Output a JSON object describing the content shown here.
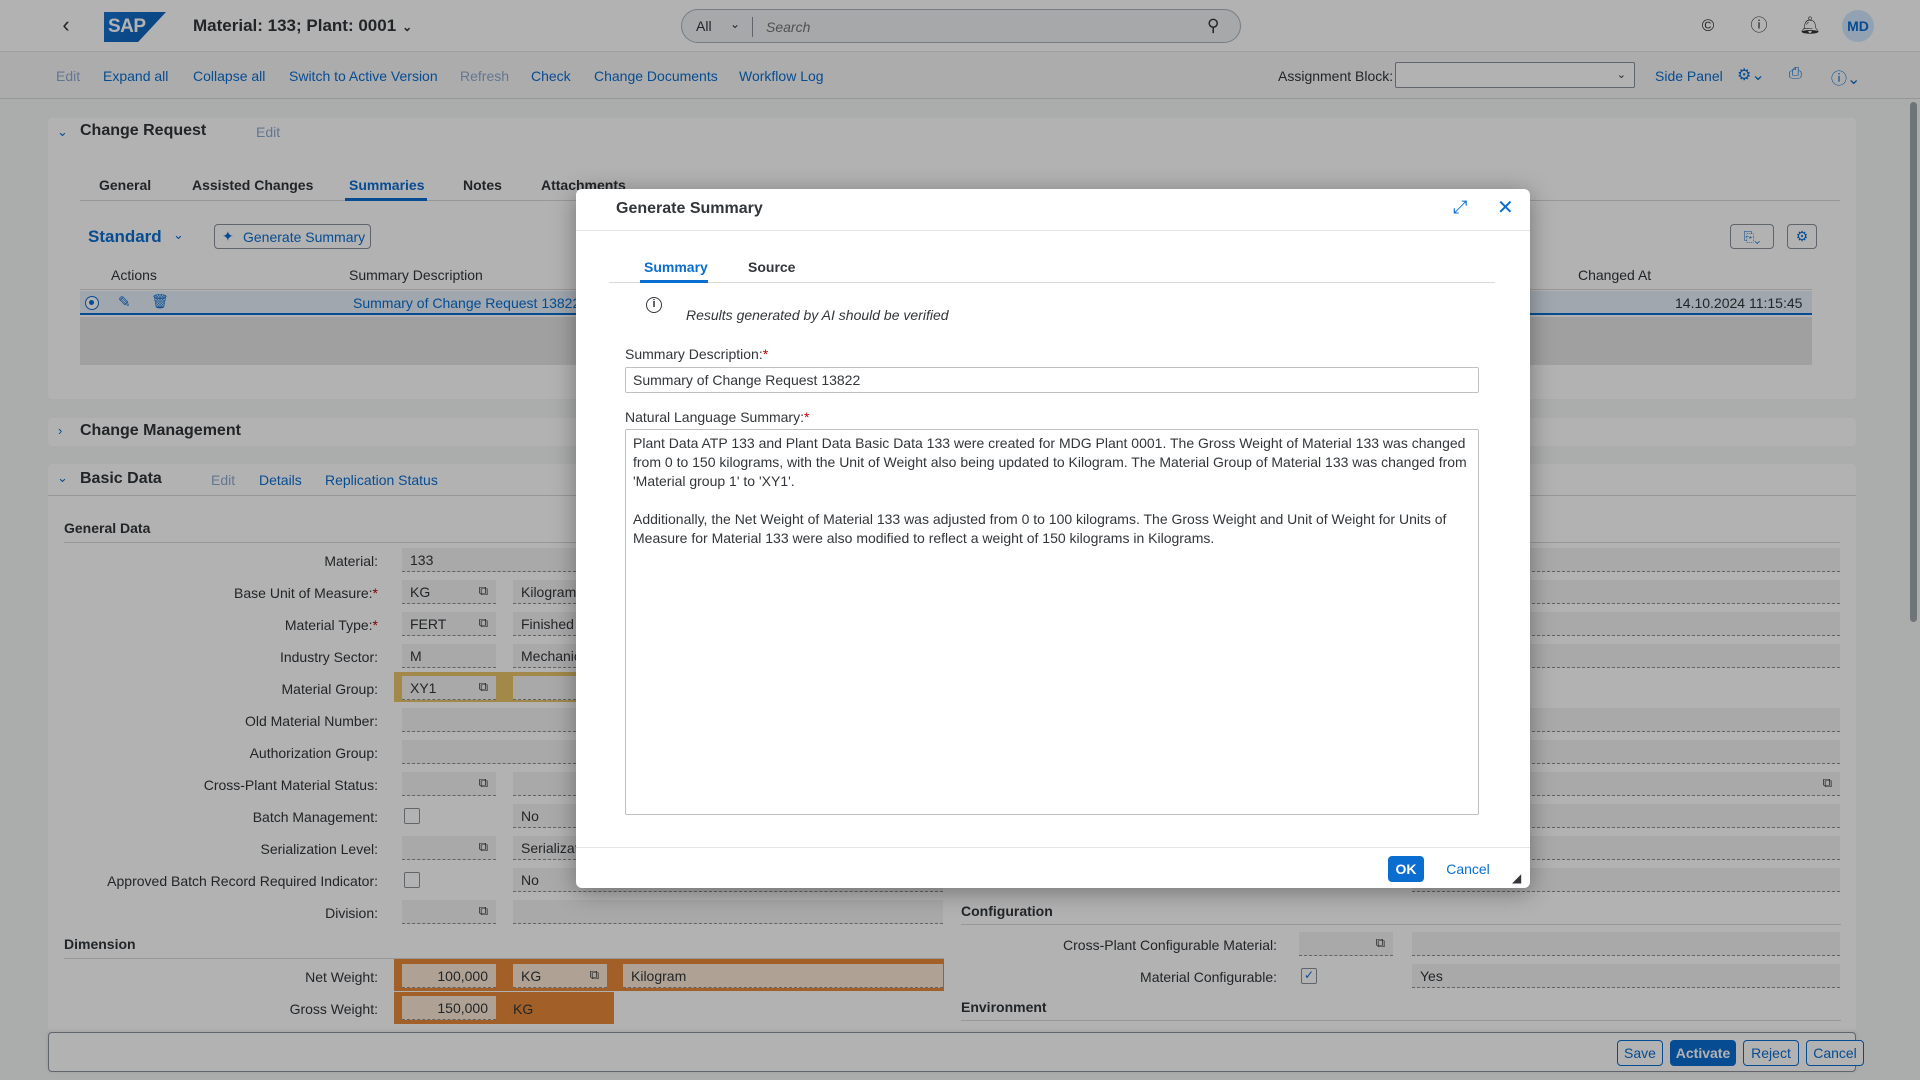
{
  "shell": {
    "app_title": "Material: 133; Plant: 0001",
    "logo": "SAP",
    "search_scope": "All",
    "search_placeholder": "Search",
    "avatar_initials": "MD"
  },
  "toolbar": {
    "edit": "Edit",
    "expand_all": "Expand all",
    "collapse_all": "Collapse all",
    "switch_active": "Switch to Active Version",
    "refresh": "Refresh",
    "check": "Check",
    "change_documents": "Change Documents",
    "workflow_log": "Workflow Log",
    "assignment_block_label": "Assignment Block:",
    "assignment_block_value": "",
    "side_panel": "Side Panel"
  },
  "change_request": {
    "title": "Change Request",
    "edit": "Edit",
    "tabs": [
      "General",
      "Assisted Changes",
      "Summaries",
      "Notes",
      "Attachments"
    ],
    "active_tab": "Summaries",
    "variant": "Standard",
    "generate_button": "Generate Summary",
    "columns": {
      "actions": "Actions",
      "description": "Summary Description",
      "changed_at": "Changed At"
    },
    "row": {
      "description": "Summary of Change Request 13822",
      "changed_at": "14.10.2024 11:15:45"
    }
  },
  "change_management": {
    "title": "Change Management"
  },
  "basic_data": {
    "title": "Basic Data",
    "links": {
      "edit": "Edit",
      "details": "Details",
      "replication": "Replication Status"
    },
    "general_data_title": "General Data",
    "dimension_title": "Dimension",
    "configuration_title": "Configuration",
    "environment_title": "Environment",
    "fields": {
      "material": {
        "label": "Material:",
        "value": "133"
      },
      "base_uom": {
        "label": "Base Unit of Measure:",
        "value": "KG",
        "desc": "Kilogram"
      },
      "material_type": {
        "label": "Material Type:",
        "value": "FERT",
        "desc": "Finished"
      },
      "industry_sector": {
        "label": "Industry Sector:",
        "value": "M",
        "desc": "Mechanic"
      },
      "material_group": {
        "label": "Material Group:",
        "value": "XY1",
        "desc": ""
      },
      "old_material_number": {
        "label": "Old Material Number:",
        "value": ""
      },
      "authorization_group": {
        "label": "Authorization Group:",
        "value": ""
      },
      "cross_plant_status": {
        "label": "Cross-Plant Material Status:",
        "value": ""
      },
      "batch_management": {
        "label": "Batch Management:",
        "desc": "No"
      },
      "serialization_level": {
        "label": "Serialization Level:",
        "desc": "Serializat"
      },
      "approved_batch": {
        "label": "Approved Batch Record Required Indicator:",
        "desc": "No"
      },
      "division": {
        "label": "Division:",
        "value": ""
      },
      "net_weight": {
        "label": "Net Weight:",
        "value": "100,000",
        "unit": "KG",
        "unit_desc": "Kilogram"
      },
      "gross_weight": {
        "label": "Gross Weight:",
        "value": "150,000",
        "unit": "KG"
      },
      "cross_plant_config": {
        "label": "Cross-Plant Configurable Material:",
        "value": ""
      },
      "material_configurable": {
        "label": "Material Configurable:",
        "desc": "Yes"
      }
    }
  },
  "dialog": {
    "title": "Generate Summary",
    "tabs": [
      "Summary",
      "Source"
    ],
    "info_text": "Results generated by AI should be verified",
    "description_label": "Summary Description:",
    "description_value": "Summary of Change Request 13822",
    "nl_label": "Natural Language Summary:",
    "nl_value": "Plant Data ATP 133 and Plant Data Basic Data 133 were created for MDG Plant 0001. The Gross Weight of Material 133 was changed from 0 to 150 kilograms, with the Unit of Weight also being updated to Kilogram. The Material Group of Material 133 was changed from 'Material group 1' to 'XY1'.\n\nAdditionally, the Net Weight of Material 133 was adjusted from 0 to 100 kilograms. The Gross Weight and Unit of Weight for Units of Measure for Material 133 were also modified to reflect a weight of 150 kilograms in Kilograms.",
    "ok": "OK",
    "cancel": "Cancel"
  },
  "footer": {
    "save": "Save",
    "activate": "Activate",
    "reject": "Reject",
    "cancel": "Cancel"
  },
  "colors": {
    "accent": "#0a6ed1",
    "changed": "#e9c56b",
    "changed_strong": "#e88a3a",
    "required": "#bb0000"
  }
}
